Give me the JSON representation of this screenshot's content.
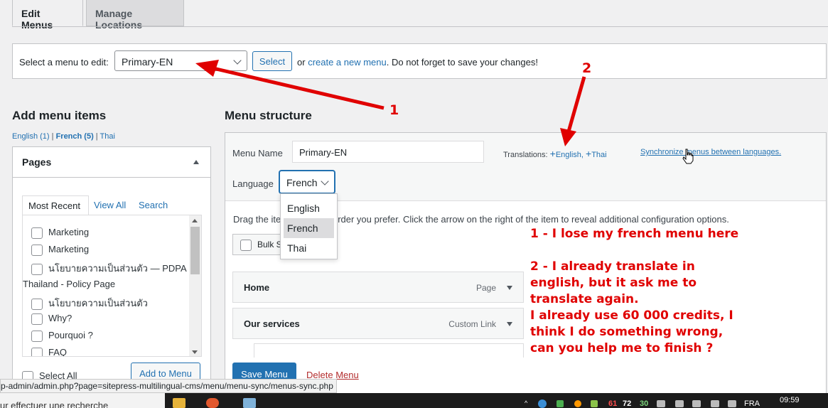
{
  "tabs": {
    "edit": "Edit Menus",
    "manage": "Manage Locations"
  },
  "manage_bar": {
    "label": "Select a menu to edit:",
    "selected_menu": "Primary-EN",
    "select_button": "Select",
    "or_text": "or",
    "create_link": "create a new menu",
    "save_reminder": ". Do not forget to save your changes!"
  },
  "left": {
    "title": "Add menu items",
    "lang_links": {
      "english": "English (1)",
      "sep1": " | ",
      "french": "French (5)",
      "sep2": " | ",
      "thai": "Thai"
    },
    "pages": {
      "title": "Pages",
      "tabs": [
        "Most Recent",
        "View All",
        "Search"
      ],
      "items": [
        {
          "label": "Marketing",
          "checkbox": true
        },
        {
          "label": "Marketing",
          "checkbox": true
        },
        {
          "label": "นโยบายความเป็นส่วนตัว — PDPA",
          "checkbox": true
        },
        {
          "label": "Thailand - Policy Page",
          "checkbox": false
        },
        {
          "label": "นโยบายความเป็นส่วนตัว",
          "checkbox": true
        },
        {
          "label": "Why?",
          "checkbox": true
        },
        {
          "label": "Pourquoi ?",
          "checkbox": true
        },
        {
          "label": "FAQ",
          "checkbox": true
        }
      ],
      "select_all": "Select All",
      "add_button": "Add to Menu"
    }
  },
  "right": {
    "title": "Menu structure",
    "menu_name_label": "Menu Name",
    "menu_name_value": "Primary-EN",
    "translations_label": "Translations:",
    "translation_en": "English,",
    "translation_th": "Thai",
    "sync_link": "Synchronize menus between languages.",
    "language_label": "Language",
    "language_value": "French",
    "language_options": [
      "English",
      "French",
      "Thai"
    ],
    "instructions": "Drag the ite",
    "instructions_tail": "rder you prefer. Click the arrow on the right of the item to reveal additional configuration options.",
    "bulk_label": "Bulk S",
    "items": [
      {
        "title": "Home",
        "type": "Page"
      },
      {
        "title": "Our services",
        "type": "Custom Link"
      }
    ],
    "save_button": "Save Menu",
    "delete_link": "Delete Menu"
  },
  "annotations": {
    "num1": "1",
    "num2": "2",
    "note1": "1 - I lose my french menu here",
    "note2_lines": [
      "2 - I already translate in",
      "english, but it ask me to",
      "translate again.",
      "I already use 60 000  credits, I",
      "think I do something wrong,",
      "can you help me to finish ?"
    ]
  },
  "status_url": "p-admin/admin.php?page=sitepress-multilingual-cms/menu/menu-sync/menus-sync.php",
  "taskbar": {
    "search_text": "ur effectuer une recherche",
    "tray_nums": [
      "61",
      "72",
      "30"
    ],
    "lang": "FRA",
    "time": "09:59"
  },
  "colors": {
    "accent": "#2271b1",
    "annotation": "#e00000",
    "danger": "#b32d2e"
  }
}
